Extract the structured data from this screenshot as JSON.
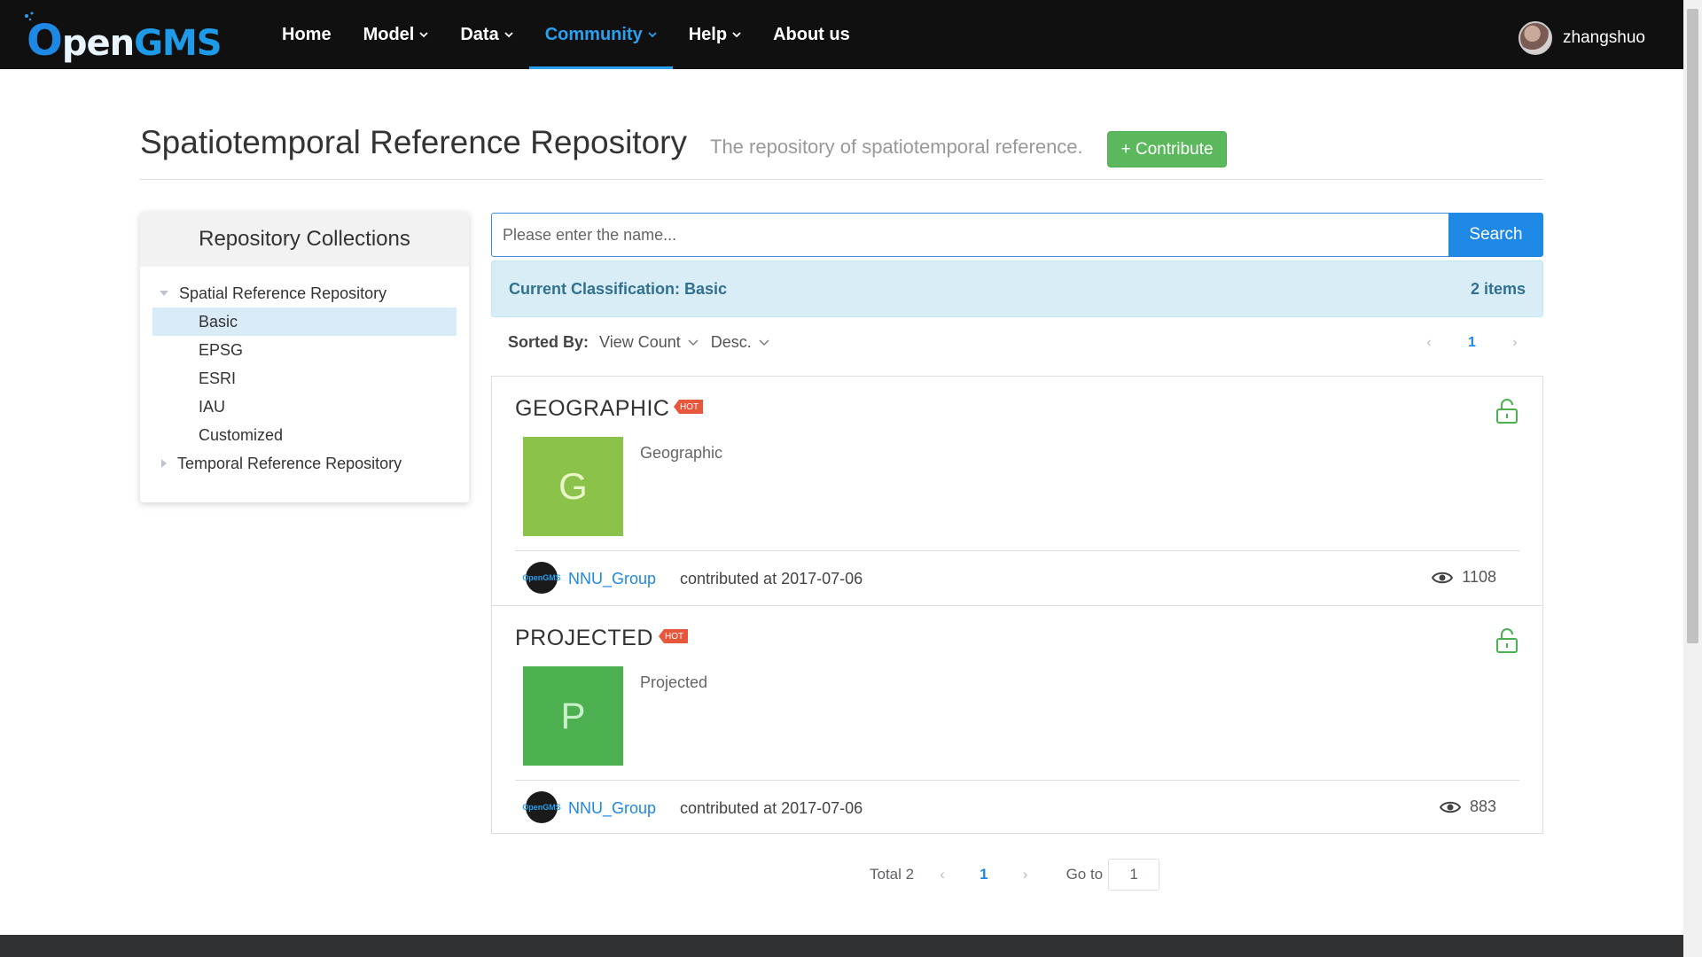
{
  "nav": {
    "logo": {
      "o": "O",
      "pen": "pen",
      "gms": "GMS"
    },
    "items": [
      {
        "label": "Home"
      },
      {
        "label": "Model"
      },
      {
        "label": "Data"
      },
      {
        "label": "Community"
      },
      {
        "label": "Help"
      },
      {
        "label": "About us"
      }
    ],
    "active": "Community",
    "user": "zhangshuo"
  },
  "header": {
    "title": "Spatiotemporal Reference Repository",
    "subtitle": "The repository of spatiotemporal reference.",
    "contribute_label": "+ Contribute"
  },
  "sidebar": {
    "title": "Repository Collections",
    "tree": [
      {
        "label": "Spatial Reference Repository",
        "expanded": true,
        "children": [
          "Basic",
          "EPSG",
          "ESRI",
          "IAU",
          "Customized"
        ]
      },
      {
        "label": "Temporal Reference Repository",
        "expanded": false
      }
    ],
    "selected": "Basic"
  },
  "search": {
    "placeholder": "Please enter the name...",
    "button": "Search"
  },
  "classification": {
    "label": "Current Classification: Basic",
    "count": "2 items"
  },
  "sort": {
    "label": "Sorted By:",
    "field": "View Count",
    "order": "Desc."
  },
  "pager_top": {
    "prev": "‹",
    "page": "1",
    "next": "›"
  },
  "items": [
    {
      "title": "GEOGRAPHIC",
      "badge": "HOT",
      "letter": "G",
      "thumb_color": "#8bc34a",
      "letter_color": "#e8f5c8",
      "desc": "Geographic",
      "author": "NNU_Group",
      "author_avatar": "OpenGMS",
      "contributed": "contributed at 2017-07-06",
      "views": "1108"
    },
    {
      "title": "PROJECTED",
      "badge": "HOT",
      "letter": "P",
      "thumb_color": "#4caf50",
      "letter_color": "#c8f0c8",
      "desc": "Projected",
      "author": "NNU_Group",
      "author_avatar": "OpenGMS",
      "contributed": "contributed at 2017-07-06",
      "views": "883"
    }
  ],
  "pager_bottom": {
    "total": "Total 2",
    "prev": "‹",
    "page": "1",
    "next": "›",
    "goto_label": "Go to",
    "goto_value": "1"
  },
  "colors": {
    "accent": "#1e88e5",
    "success": "#5cb85c",
    "hot": "#e8563b",
    "nav_bg": "#101010"
  }
}
